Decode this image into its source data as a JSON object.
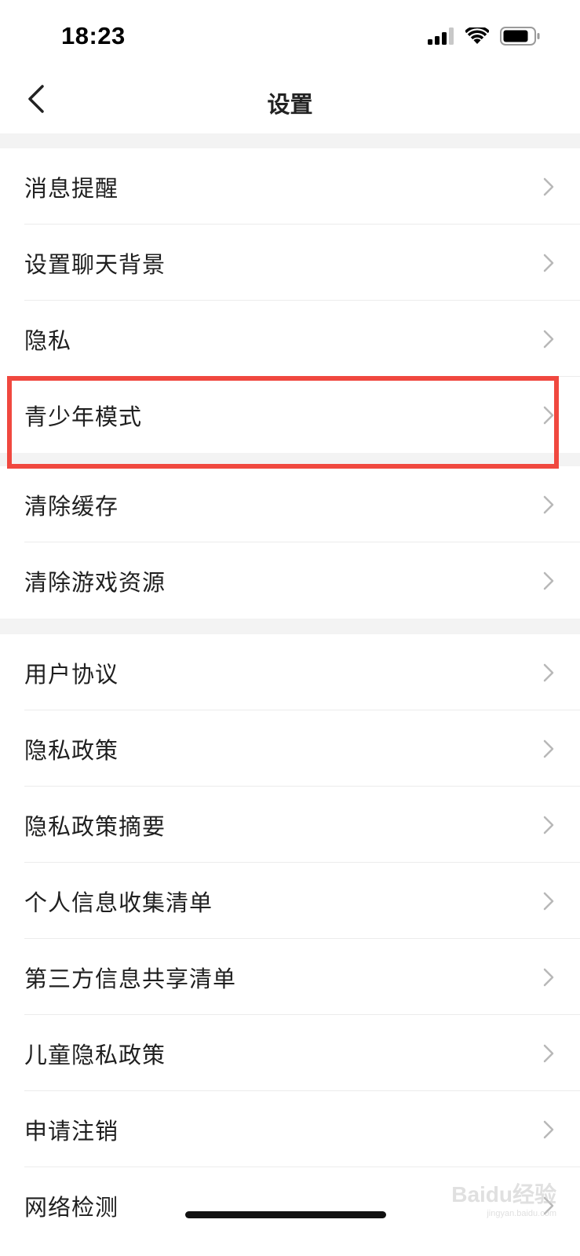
{
  "status_bar": {
    "time": "18:23",
    "signal_icon": "cellular-signal-icon",
    "wifi_icon": "wifi-icon",
    "battery_icon": "battery-icon"
  },
  "nav": {
    "back_icon": "chevron-left-icon",
    "title": "设置"
  },
  "sections": [
    {
      "items": [
        {
          "label": "消息提醒"
        },
        {
          "label": "设置聊天背景"
        },
        {
          "label": "隐私"
        },
        {
          "label": "青少年模式",
          "highlighted": true
        }
      ]
    },
    {
      "items": [
        {
          "label": "清除缓存"
        },
        {
          "label": "清除游戏资源"
        }
      ]
    },
    {
      "items": [
        {
          "label": "用户协议"
        },
        {
          "label": "隐私政策"
        },
        {
          "label": "隐私政策摘要"
        },
        {
          "label": "个人信息收集清单"
        },
        {
          "label": "第三方信息共享清单"
        },
        {
          "label": "儿童隐私政策"
        },
        {
          "label": "申请注销"
        },
        {
          "label": "网络检测"
        }
      ]
    }
  ],
  "watermark": {
    "main": "Baidu经验",
    "sub": "jingyan.baidu.com"
  },
  "colors": {
    "highlight": "#f0483f",
    "divider": "#ececec",
    "section_gap": "#f3f3f3"
  }
}
